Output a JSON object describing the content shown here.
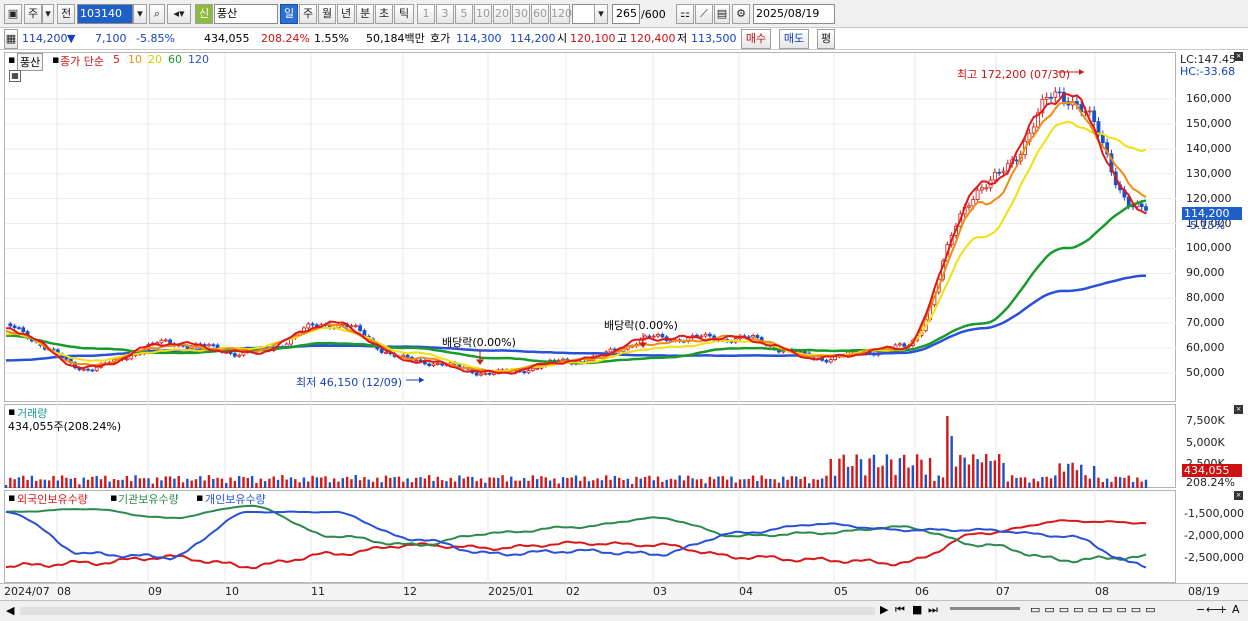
{
  "toolbar": {
    "market": "주",
    "prev": "전",
    "code": "103140",
    "stock_badge": "신",
    "stock_name": "풍산",
    "periods": [
      "일",
      "주",
      "월",
      "년",
      "분",
      "초",
      "틱"
    ],
    "minutes": [
      "1",
      "3",
      "5",
      "10",
      "20",
      "30",
      "60",
      "120"
    ],
    "count": "265",
    "count_total": "/600",
    "date": "2025/08/19"
  },
  "quote": {
    "price": "114,200",
    "arrow": "▼",
    "change": "7,100",
    "change_pct": "-5.85%",
    "volume": "434,055",
    "volume_ratio": "208.24%",
    "turnover": "1.55%",
    "amount": "50,184백만",
    "ask_label": "호가",
    "ask": "114,300",
    "bid": "114,200",
    "open_label": "시",
    "open": "120,100",
    "high_label": "고",
    "high": "120,400",
    "low_label": "저",
    "low": "113,500",
    "buy": "매수",
    "sell": "매도",
    "eval": "평"
  },
  "price_panel": {
    "name": "풍산",
    "legend_title": "종가 단순",
    "ma_labels": [
      "5",
      "10",
      "20",
      "60",
      "120"
    ],
    "ma_colors": [
      "#e01818",
      "#f08c10",
      "#f0e010",
      "#1a9a2a",
      "#2850d8"
    ],
    "lc": "LC:147.45",
    "hc": "HC:-33.68",
    "current": "114,200",
    "current_pct": "-5.15%",
    "high_note": "최고 172,200 (07/30)",
    "low_note": "최저 46,150 (12/09)",
    "dividend_1": "배당락(0.00%)",
    "dividend_2": "배당락(0.00%)",
    "yaxis": [
      "160,000",
      "150,000",
      "140,000",
      "130,000",
      "120,000",
      "110,000",
      "100,000",
      "90,000",
      "80,000",
      "70,000",
      "60,000",
      "50,000"
    ]
  },
  "volume_panel": {
    "title": "거래량",
    "value": "434,055주(208.24%)",
    "yaxis": [
      "7,500K",
      "5,000K",
      "2,500K"
    ],
    "current": "434,055",
    "current_pct": "208.24%"
  },
  "holder_panel": {
    "series": [
      "외국인보유수량",
      "기관보유수량",
      "개인보유수량"
    ],
    "colors": [
      "#d81818",
      "#2a8a4a",
      "#2850d8"
    ],
    "yaxis": [
      "-1,500,000",
      "-2,000,000",
      "-2,500,000"
    ]
  },
  "xaxis": [
    "2024/07",
    "08",
    "09",
    "10",
    "11",
    "12",
    "2025/01",
    "02",
    "03",
    "04",
    "05",
    "06",
    "07",
    "08"
  ],
  "xaxis_right": "08/19",
  "chart_data": {
    "type": "line",
    "title": "",
    "x": [
      "2024/07",
      "2024/08",
      "2024/09",
      "2024/10",
      "2024/11",
      "2024/12",
      "2025/01",
      "2025/02",
      "2025/03",
      "2025/04",
      "2025/05",
      "2025/06",
      "2025/07",
      "2025/08",
      "2025/08/19"
    ],
    "series": [
      {
        "name": "5",
        "values": [
          68000,
          52000,
          62000,
          58000,
          70000,
          55000,
          50000,
          55000,
          64000,
          64000,
          56000,
          60000,
          125000,
          162000,
          114200
        ]
      },
      {
        "name": "10",
        "values": [
          67000,
          53000,
          61000,
          59000,
          69000,
          56000,
          50500,
          55000,
          62000,
          64500,
          56500,
          60000,
          118000,
          158000,
          122000
        ]
      },
      {
        "name": "20",
        "values": [
          66000,
          55000,
          59000,
          60000,
          68000,
          58000,
          51000,
          54000,
          60000,
          63000,
          57000,
          59500,
          105000,
          150000,
          140000
        ]
      },
      {
        "name": "60",
        "values": [
          65000,
          60000,
          58000,
          59000,
          62000,
          60000,
          56000,
          54000,
          56000,
          60000,
          59000,
          59000,
          70000,
          100000,
          119000
        ]
      },
      {
        "name": "120",
        "values": [
          55000,
          57000,
          59000,
          60000,
          61000,
          60500,
          59000,
          58000,
          57000,
          57000,
          57000,
          58000,
          68000,
          83000,
          89000
        ]
      }
    ],
    "ylim": [
      42000,
      172200
    ],
    "annotations": [
      "최고 172,200 (07/30)",
      "최저 46,150 (12/09)",
      "배당락(0.00%)",
      "배당락(0.00%)"
    ]
  }
}
